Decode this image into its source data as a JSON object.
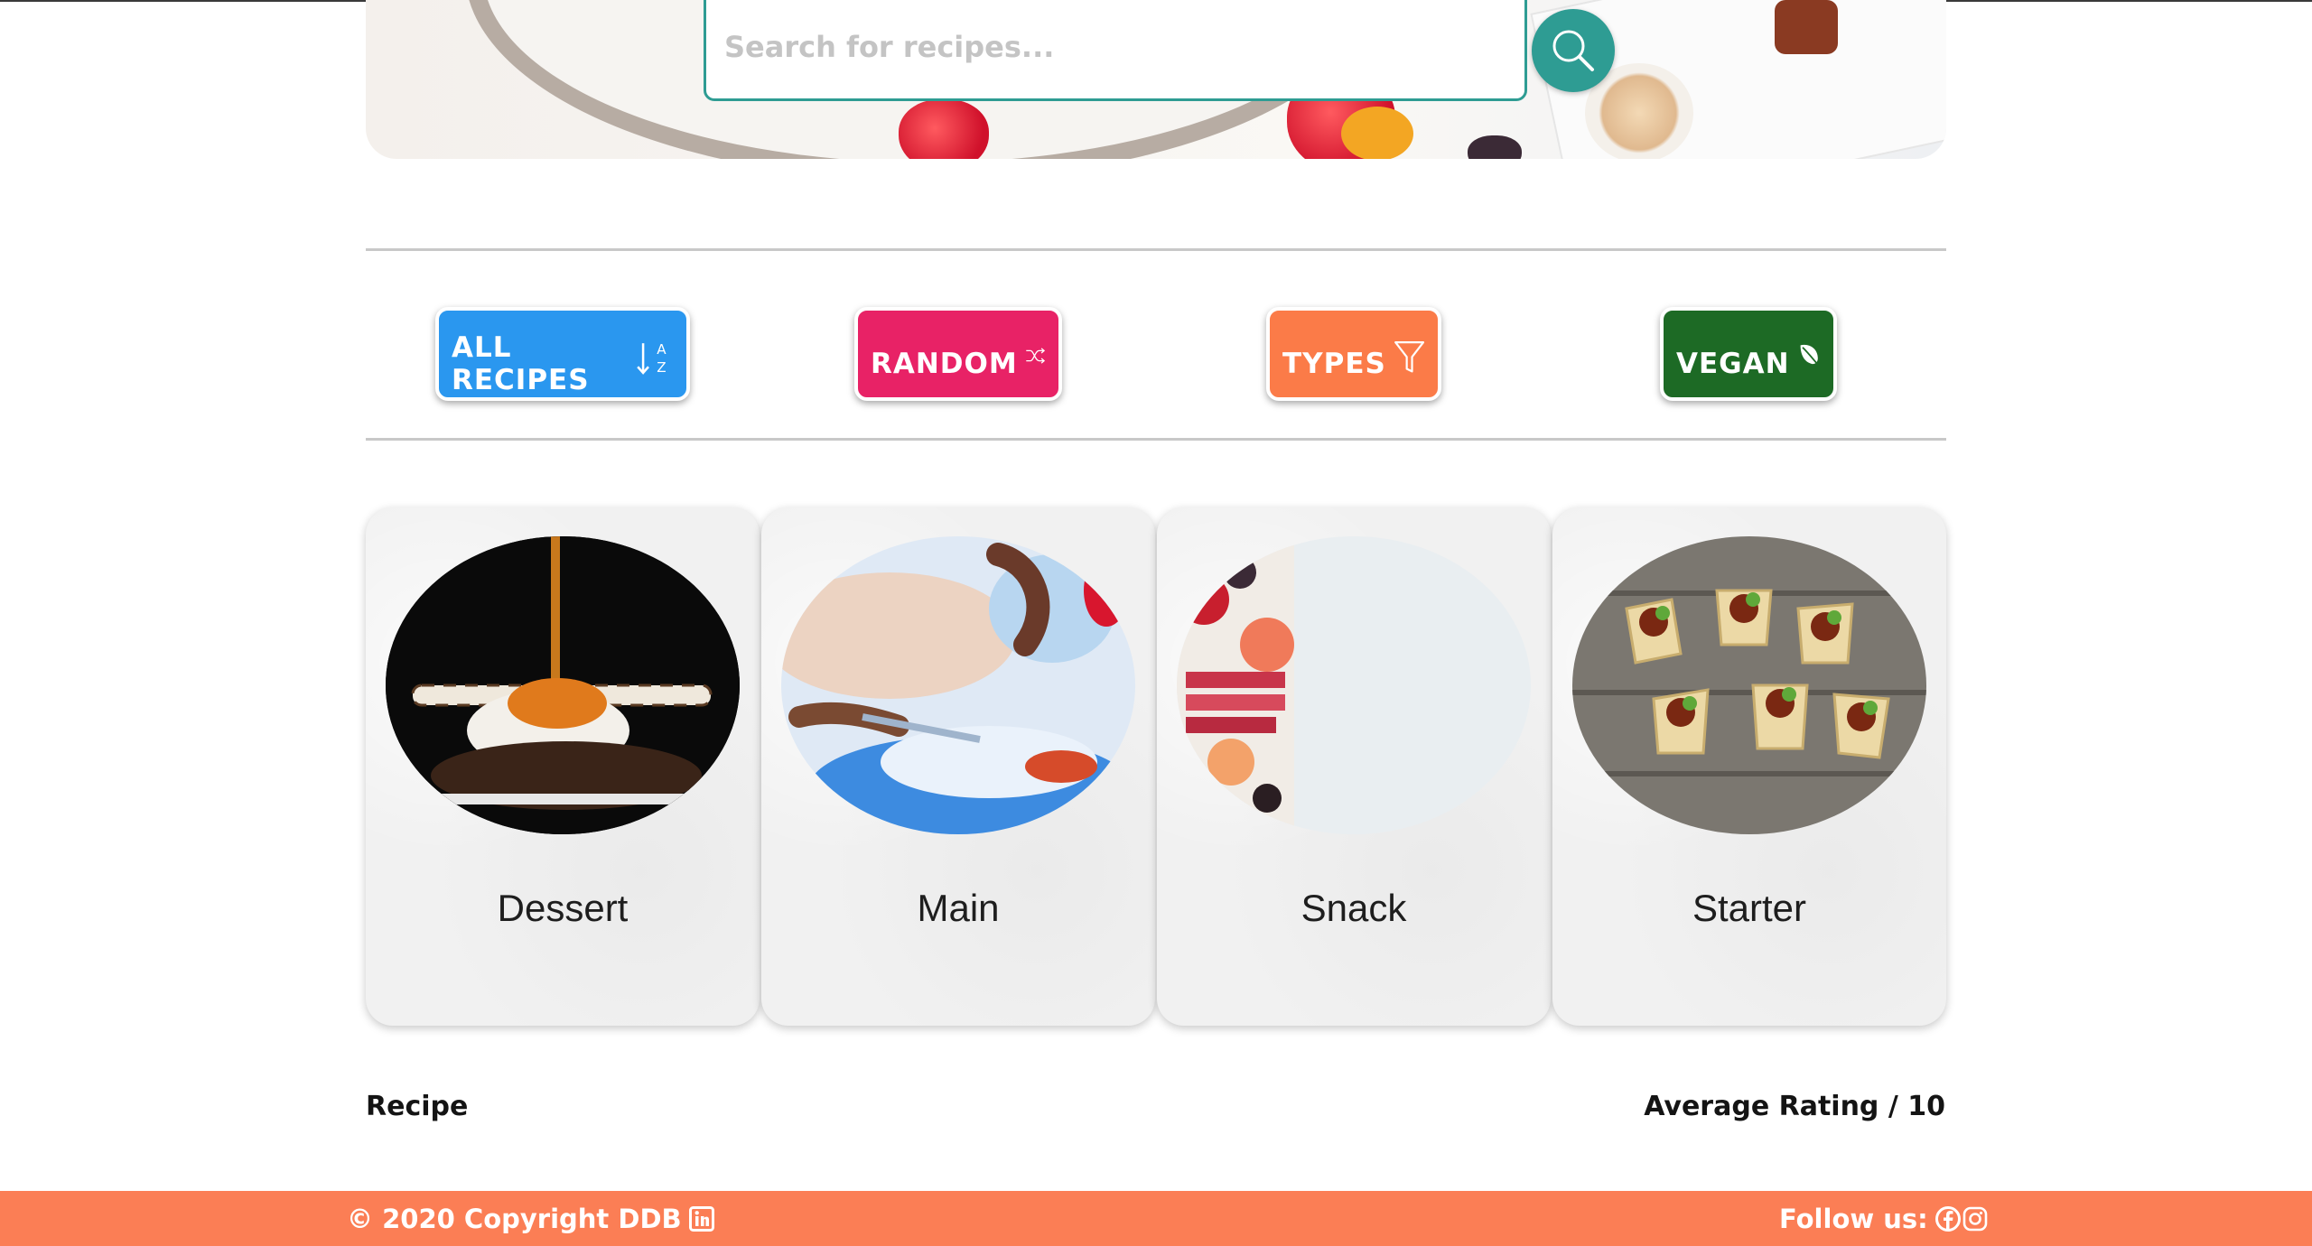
{
  "search": {
    "placeholder": "Search for recipes..."
  },
  "filters": [
    {
      "label": "ALL RECIPES",
      "icon": "sort-alpha-down-icon",
      "color": "#2a97ef"
    },
    {
      "label": "RANDOM",
      "icon": "shuffle-icon",
      "color": "#e82266"
    },
    {
      "label": "TYPES",
      "icon": "filter-icon",
      "color": "#fb7b48"
    },
    {
      "label": "VEGAN",
      "icon": "leaf-icon",
      "color": "#1d6a25"
    }
  ],
  "categories": [
    {
      "name": "Dessert"
    },
    {
      "name": "Main"
    },
    {
      "name": "Snack"
    },
    {
      "name": "Starter"
    }
  ],
  "list_header": {
    "left": "Recipe",
    "right": "Average Rating / 10"
  },
  "footer": {
    "copyright": "© 2020 Copyright DDB",
    "follow": "Follow us:",
    "color": "#fb7e55"
  },
  "colors": {
    "accent": "#2e9c93"
  }
}
